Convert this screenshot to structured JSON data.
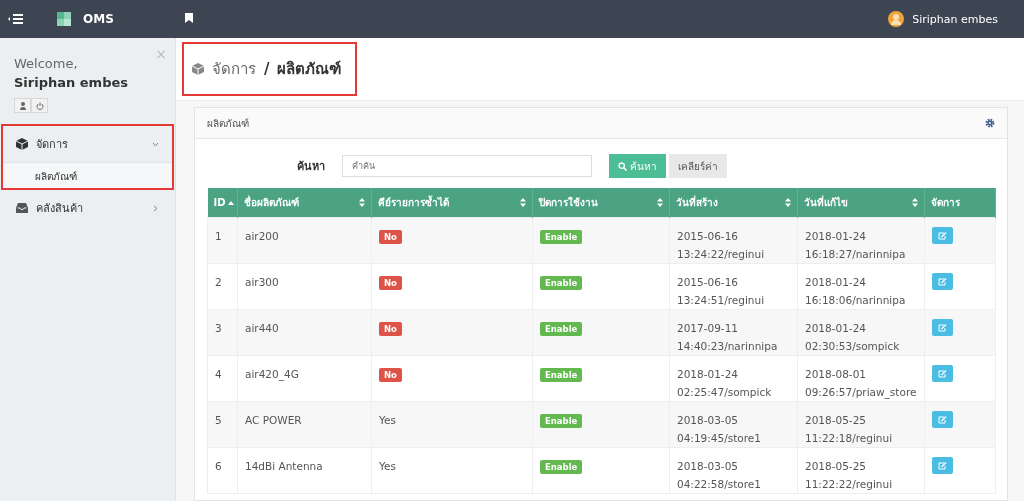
{
  "topbar": {
    "brand": "OMS",
    "user_name": "Siriphan embes"
  },
  "sidebar": {
    "close": "×",
    "welcome": "Welcome,",
    "user_name": "Siriphan embes",
    "menu": [
      {
        "label": "จัดการ",
        "expanded": true,
        "highlighted": true,
        "children": [
          {
            "label": "ผลิตภัณฑ์",
            "selected": true
          }
        ]
      },
      {
        "label": "คลังสินค้า",
        "expanded": false,
        "highlighted": false
      }
    ]
  },
  "breadcrumb": {
    "parent": "จัดการ",
    "separator": "/",
    "current": "ผลิตภัณฑ์",
    "highlighted": true
  },
  "panel": {
    "title": "ผลิตภัณฑ์",
    "search": {
      "label": "ค้นหา",
      "placeholder": "คำค้น",
      "button": "ค้นหา",
      "clear": "เคลียร์ค่า"
    },
    "table": {
      "columns": [
        {
          "label": "ID",
          "sortable": true,
          "sorted": true
        },
        {
          "label": "ชื่อผลิตภัณฑ์",
          "sortable": true,
          "sorted": false
        },
        {
          "label": "คีย์รายการซ้ำได้",
          "sortable": true,
          "sorted": false
        },
        {
          "label": "ปิดการใช้งาน",
          "sortable": true,
          "sorted": false
        },
        {
          "label": "วันที่สร้าง",
          "sortable": true,
          "sorted": false
        },
        {
          "label": "วันที่แก้ไข",
          "sortable": true,
          "sorted": false
        },
        {
          "label": "จัดการ",
          "sortable": false,
          "sorted": false
        }
      ],
      "rows": [
        {
          "id": "1",
          "name": "air200",
          "duplicate": {
            "kind": "badge",
            "text": "No"
          },
          "status": "Enable",
          "created": "2015-06-16 13:24:22/reginui",
          "modified": "2018-01-24 16:18:27/narinnipa"
        },
        {
          "id": "2",
          "name": "air300",
          "duplicate": {
            "kind": "badge",
            "text": "No"
          },
          "status": "Enable",
          "created": "2015-06-16 13:24:51/reginui",
          "modified": "2018-01-24 16:18:06/narinnipa"
        },
        {
          "id": "3",
          "name": "air440",
          "duplicate": {
            "kind": "badge",
            "text": "No"
          },
          "status": "Enable",
          "created": "2017-09-11 14:40:23/narinnipa",
          "modified": "2018-01-24 02:30:53/sompick"
        },
        {
          "id": "4",
          "name": "air420_4G",
          "duplicate": {
            "kind": "badge",
            "text": "No"
          },
          "status": "Enable",
          "created": "2018-01-24 02:25:47/sompick",
          "modified": "2018-08-01 09:26:57/priaw_store"
        },
        {
          "id": "5",
          "name": "AC POWER",
          "duplicate": {
            "kind": "text",
            "text": "Yes"
          },
          "status": "Enable",
          "created": "2018-03-05 04:19:45/store1",
          "modified": "2018-05-25 11:22:18/reginui"
        },
        {
          "id": "6",
          "name": "14dBi Antenna",
          "duplicate": {
            "kind": "text",
            "text": "Yes"
          },
          "status": "Enable",
          "created": "2018-03-05 04:22:58/store1",
          "modified": "2018-05-25 11:22:22/reginui"
        }
      ]
    }
  }
}
